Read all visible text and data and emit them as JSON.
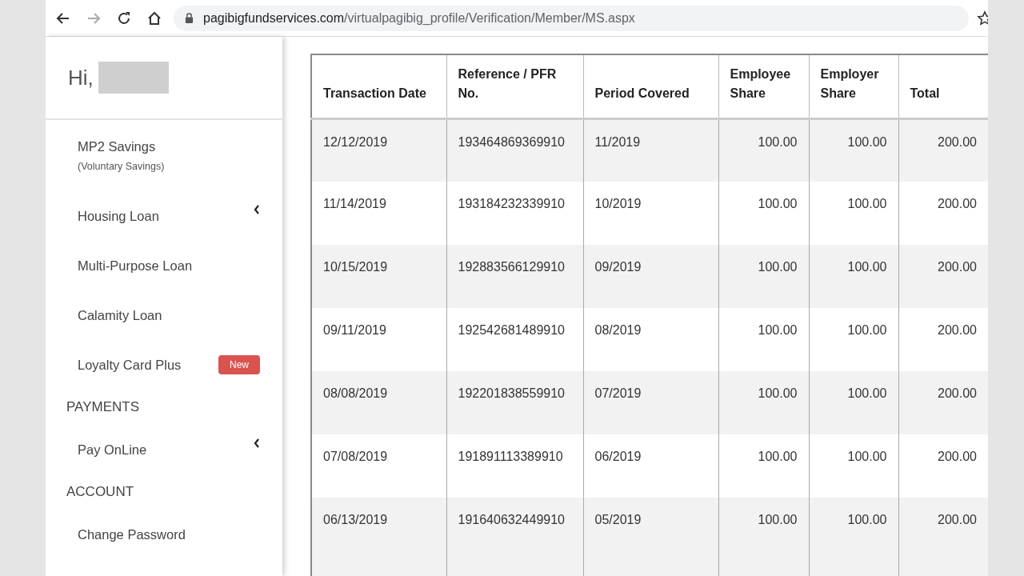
{
  "browser": {
    "back_disabled": false,
    "forward_disabled": true,
    "url": {
      "domain": "pagibigfundservices.com",
      "path": "/virtualpagibig_profile/Verification/Member/MS.aspx"
    }
  },
  "sidebar": {
    "greeting": "Hi,",
    "items": [
      {
        "kind": "link",
        "label": "MP2 Savings",
        "sublabel": "(Voluntary Savings)",
        "expandable": false
      },
      {
        "kind": "link",
        "label": "Housing Loan",
        "expandable": true
      },
      {
        "kind": "link",
        "label": "Multi-Purpose Loan",
        "expandable": false
      },
      {
        "kind": "link",
        "label": "Calamity Loan",
        "expandable": false
      },
      {
        "kind": "link",
        "label": "Loyalty Card Plus",
        "badge": "New",
        "expandable": false
      },
      {
        "kind": "section",
        "label": "PAYMENTS"
      },
      {
        "kind": "link",
        "label": "Pay OnLine",
        "expandable": true
      },
      {
        "kind": "section",
        "label": "ACCOUNT"
      },
      {
        "kind": "link",
        "label": "Change Password",
        "expandable": false
      }
    ]
  },
  "table": {
    "columns": [
      "Transaction Date",
      "Reference / PFR No.",
      "Period Covered",
      "Employee Share",
      "Employer Share",
      "Total"
    ],
    "rows": [
      [
        "12/12/2019",
        "193464869369910",
        "11/2019",
        "100.00",
        "100.00",
        "200.00"
      ],
      [
        "11/14/2019",
        "193184232339910",
        "10/2019",
        "100.00",
        "100.00",
        "200.00"
      ],
      [
        "10/15/2019",
        "192883566129910",
        "09/2019",
        "100.00",
        "100.00",
        "200.00"
      ],
      [
        "09/11/2019",
        "192542681489910",
        "08/2019",
        "100.00",
        "100.00",
        "200.00"
      ],
      [
        "08/08/2019",
        "192201838559910",
        "07/2019",
        "100.00",
        "100.00",
        "200.00"
      ],
      [
        "07/08/2019",
        "191891113389910",
        "06/2019",
        "100.00",
        "100.00",
        "200.00"
      ],
      [
        "06/13/2019",
        "191640632449910",
        "05/2019",
        "100.00",
        "100.00",
        "200.00"
      ]
    ]
  }
}
